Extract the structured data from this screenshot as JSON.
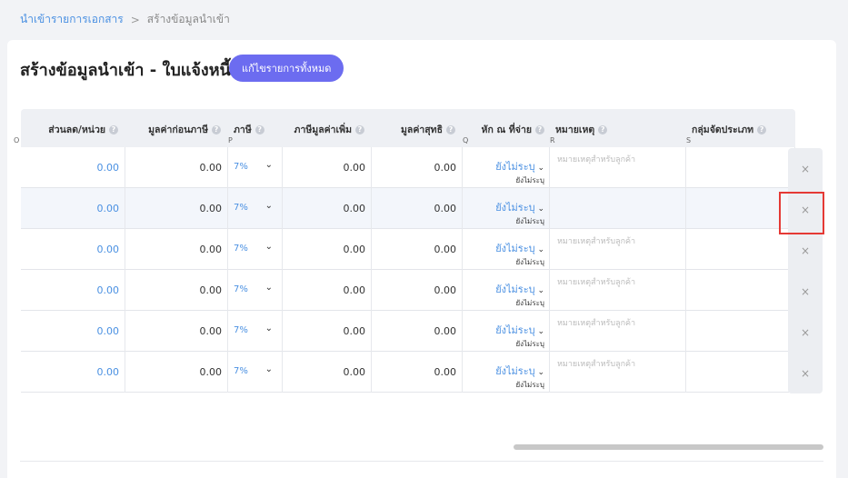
{
  "breadcrumb": {
    "parent": "นำเข้ารายการเอกสาร",
    "separator": ">",
    "current": "สร้างข้อมูลนำเข้า"
  },
  "page": {
    "title": "สร้างข้อมูลนำเข้า - ใบแจ้งหนี้",
    "edit_all_label": "แก้ไขรายการทั้งหมด"
  },
  "columns": [
    {
      "label": "ส่วนลด/หน่วย",
      "code": "O"
    },
    {
      "label": "มูลค่าก่อนภาษี",
      "code": ""
    },
    {
      "label": "ภาษี",
      "code": "P"
    },
    {
      "label": "ภาษีมูลค่าเพิ่ม",
      "code": ""
    },
    {
      "label": "มูลค่าสุทธิ",
      "code": ""
    },
    {
      "label": "หัก ณ ที่จ่าย",
      "code": "Q"
    },
    {
      "label": "หมายเหตุ",
      "code": "R"
    },
    {
      "label": "กลุ่มจัดประเภท",
      "code": "S"
    }
  ],
  "rows": [
    {
      "discount": "0.00",
      "pretax": "0.00",
      "tax": "7%",
      "vat": "0.00",
      "net": "0.00",
      "wht": "ยังไม่ระบุ",
      "wht_sub": "ยังไม่ระบุ",
      "note_placeholder": "หมายเหตุสำหรับลูกค้า"
    },
    {
      "discount": "0.00",
      "pretax": "0.00",
      "tax": "7%",
      "vat": "0.00",
      "net": "0.00",
      "wht": "ยังไม่ระบุ",
      "wht_sub": "ยังไม่ระบุ",
      "note_placeholder": ""
    },
    {
      "discount": "0.00",
      "pretax": "0.00",
      "tax": "7%",
      "vat": "0.00",
      "net": "0.00",
      "wht": "ยังไม่ระบุ",
      "wht_sub": "ยังไม่ระบุ",
      "note_placeholder": "หมายเหตุสำหรับลูกค้า"
    },
    {
      "discount": "0.00",
      "pretax": "0.00",
      "tax": "7%",
      "vat": "0.00",
      "net": "0.00",
      "wht": "ยังไม่ระบุ",
      "wht_sub": "ยังไม่ระบุ",
      "note_placeholder": "หมายเหตุสำหรับลูกค้า"
    },
    {
      "discount": "0.00",
      "pretax": "0.00",
      "tax": "7%",
      "vat": "0.00",
      "net": "0.00",
      "wht": "ยังไม่ระบุ",
      "wht_sub": "ยังไม่ระบุ",
      "note_placeholder": "หมายเหตุสำหรับลูกค้า"
    },
    {
      "discount": "0.00",
      "pretax": "0.00",
      "tax": "7%",
      "vat": "0.00",
      "net": "0.00",
      "wht": "ยังไม่ระบุ",
      "wht_sub": "ยังไม่ระบุ",
      "note_placeholder": "หมายเหตุสำหรับลูกค้า"
    }
  ],
  "delete_label": "×",
  "icons": {
    "help": "question-circle-icon",
    "dropdown": "chevron-down-icon",
    "delete": "close-icon"
  },
  "colors": {
    "accent": "#6c6cf0",
    "link": "#4a90e2",
    "highlight": "#e53935"
  }
}
